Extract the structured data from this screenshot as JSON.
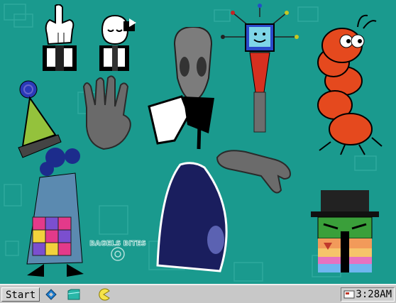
{
  "desktop": {
    "background_color": "#1a9a8e",
    "watermark_text": "BAGELS BITES",
    "sprites": [
      "pointing-glove-creature-icon",
      "sleeping-ghost-creature-icon",
      "tv-head-robot-icon",
      "red-caterpillar-icon",
      "spiral-wizard-clown-icon",
      "grey-hand-icon",
      "alien-statue-icon",
      "reaching-grey-hand-icon",
      "top-hat-box-creature-icon"
    ]
  },
  "taskbar": {
    "start_label": "Start",
    "quick_launch": [
      "spiral-icon",
      "folder-icon",
      "pacman-icon"
    ],
    "clock": "3:28AM",
    "tray_icon": "notification-tray-icon"
  }
}
